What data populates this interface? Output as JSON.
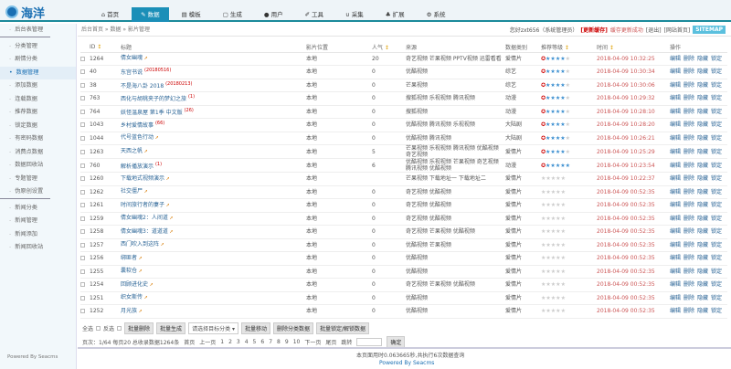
{
  "app": {
    "logo": "海洋"
  },
  "nav": [
    {
      "icon": "home-icon",
      "glyph": "⌂",
      "label": "首页"
    },
    {
      "icon": "edit-icon",
      "glyph": "✎",
      "label": "数据",
      "active": true
    },
    {
      "icon": "file-icon",
      "glyph": "▤",
      "label": "模板"
    },
    {
      "icon": "doc-icon",
      "glyph": "▢",
      "label": "生成"
    },
    {
      "icon": "user-icon",
      "glyph": "●",
      "label": "用户"
    },
    {
      "icon": "wrench-icon",
      "glyph": "✐",
      "label": "工具"
    },
    {
      "icon": "magnet-icon",
      "glyph": "∪",
      "label": "采集"
    },
    {
      "icon": "puzzle-icon",
      "glyph": "♣",
      "label": "扩展"
    },
    {
      "icon": "gear-icon",
      "glyph": "⚙",
      "label": "系统"
    }
  ],
  "sidebar": {
    "items": [
      {
        "label": "后台表管理",
        "sep": true
      },
      {
        "label": "分类管理"
      },
      {
        "label": "剧情分类"
      },
      {
        "label": "数据管理",
        "active": true
      },
      {
        "label": "添加数据"
      },
      {
        "label": "连载数据"
      },
      {
        "label": "推荐数据"
      },
      {
        "label": "锁定数据"
      },
      {
        "label": "有密码数据"
      },
      {
        "label": "消费点数据"
      },
      {
        "label": "数据回收站"
      },
      {
        "label": "专题管理"
      },
      {
        "label": "伪原创设置",
        "sep": true
      },
      {
        "label": "新闻分类"
      },
      {
        "label": "新闻管理"
      },
      {
        "label": "新闻添加"
      },
      {
        "label": "新闻回收站"
      }
    ],
    "powered": "Powered By Seacms"
  },
  "breadcrumb": "后台首页 » 数据 » 影片管理",
  "userbar": {
    "greeting": "您好zxt656（系统管理员）",
    "update_cache": "[更新缓存]",
    "cache_msg": "缓存更新成功",
    "logout": "[退出]",
    "home": "[网站首页]",
    "sitemap": "SITEMAP"
  },
  "table": {
    "headers": [
      "ID",
      "标题",
      "影片位置",
      "人气",
      "来源",
      "数据类别",
      "推荐等级",
      "时间",
      "操作"
    ],
    "ops": [
      "编辑",
      "删除",
      "隐藏",
      "锁定"
    ],
    "rows": [
      {
        "id": "1264",
        "title": "倩女幽魂",
        "tag": "hot",
        "pos": "本地",
        "pop": "20",
        "src": "奇艺视频 芒果视频 PPTV视频 迅雷看看",
        "cat": "爱情片",
        "stars": 4,
        "time": "2018-04-09 10:32:25"
      },
      {
        "id": "40",
        "title": "东宫书说",
        "tag": "(20180516)",
        "pos": "本地",
        "pop": "0",
        "src": "优酷视频",
        "cat": "综艺",
        "stars": 4,
        "time": "2018-04-09 10:30:34"
      },
      {
        "id": "38",
        "title": "不是海八卦 2018",
        "tag": "(20180213)",
        "pos": "本地",
        "pop": "0",
        "src": "芒果视频",
        "cat": "综艺",
        "stars": 4,
        "time": "2018-04-09 10:30:06"
      },
      {
        "id": "763",
        "title": "西化与胡桃夹子的梦幻之旅",
        "tag": "(1)",
        "pos": "本地",
        "pop": "0",
        "src": "搜狐视频 乐视视频 腾讯视频",
        "cat": "动漫",
        "stars": 4,
        "time": "2018-04-09 10:29:32"
      },
      {
        "id": "764",
        "title": "妖怪温泉屋 第1季 中文版",
        "tag": "(26)",
        "pos": "本地",
        "pop": "0",
        "src": "搜狐视频",
        "cat": "动漫",
        "stars": 4,
        "time": "2018-04-09 10:28:10"
      },
      {
        "id": "1043",
        "title": "乡村爱情故事",
        "tag": "(66)",
        "pos": "本地",
        "pop": "0",
        "src": "优酷视频 腾讯视频 乐视视频",
        "cat": "大陆剧",
        "stars": 4,
        "time": "2018-04-09 10:28:20"
      },
      {
        "id": "1044",
        "title": "代号蓝色行动",
        "tag": "hot",
        "pos": "本地",
        "pop": "0",
        "src": "优酷视频 腾讯视频",
        "cat": "大陆剧",
        "stars": 4,
        "time": "2018-04-09 10:26:21"
      },
      {
        "id": "1263",
        "title": "天西之帆",
        "tag": "hot",
        "pos": "本地",
        "pop": "5",
        "src": "芒果视频 乐视视频 腾讯视频 优酷视频 奇艺视频",
        "cat": "爱情片",
        "stars": 4,
        "time": "2018-04-09 10:25:29"
      },
      {
        "id": "760",
        "title": "解析播放演示",
        "tag": "(1)",
        "pos": "本地",
        "pop": "6",
        "src": "优酷视频 乐视视频 芒果视频 奇艺视频 腾讯视频 优酷视频",
        "cat": "动漫",
        "stars": 5,
        "time": "2018-04-09 10:23:54"
      },
      {
        "id": "1260",
        "title": "下载地式视频演示",
        "tag": "hot",
        "pos": "本地",
        "pop": "",
        "src": "芒果视频 下载地址一 下载地址二",
        "cat": "爱情片",
        "stars": 0,
        "time": "2018-04-09 10:22:37"
      },
      {
        "id": "1262",
        "title": "社交僵尸",
        "tag": "hot",
        "pos": "本地",
        "pop": "0",
        "src": "奇艺视频 优酷视频",
        "cat": "爱情片",
        "stars": 0,
        "time": "2018-04-09 00:52:35"
      },
      {
        "id": "1261",
        "title": "时间旅行者的妻子",
        "tag": "hot",
        "pos": "本地",
        "pop": "0",
        "src": "奇艺视频 优酷视频",
        "cat": "爱情片",
        "stars": 0,
        "time": "2018-04-09 00:52:35"
      },
      {
        "id": "1259",
        "title": "倩女幽魂2：人间道",
        "tag": "hot",
        "pos": "本地",
        "pop": "0",
        "src": "奇艺视频 优酷视频",
        "cat": "爱情片",
        "stars": 0,
        "time": "2018-04-09 00:52:35"
      },
      {
        "id": "1258",
        "title": "倩女幽魂3：道道道",
        "tag": "hot",
        "pos": "本地",
        "pop": "0",
        "src": "奇艺视频 芒果视频 优酷视频",
        "cat": "爱情片",
        "stars": 0,
        "time": "2018-04-09 00:52:35"
      },
      {
        "id": "1257",
        "title": "西门吹入到这阵",
        "tag": "hot",
        "pos": "本地",
        "pop": "0",
        "src": "优酷视频 芒果视频",
        "cat": "爱情片",
        "stars": 0,
        "time": "2018-04-09 00:52:35"
      },
      {
        "id": "1256",
        "title": "绑匪者",
        "tag": "hot",
        "pos": "本地",
        "pop": "0",
        "src": "优酷视频",
        "cat": "爱情片",
        "stars": 0,
        "time": "2018-04-09 00:52:35"
      },
      {
        "id": "1255",
        "title": "囊软仓",
        "tag": "hot",
        "pos": "本地",
        "pop": "0",
        "src": "优酷视频",
        "cat": "爱情片",
        "stars": 0,
        "time": "2018-04-09 00:52:35"
      },
      {
        "id": "1254",
        "title": "回顾进化史",
        "tag": "hot",
        "pos": "本地",
        "pop": "0",
        "src": "奇艺视频 芒果视频 优酷视频",
        "cat": "爱情片",
        "stars": 0,
        "time": "2018-04-09 00:52:35"
      },
      {
        "id": "1251",
        "title": "织女斯传",
        "tag": "hot",
        "pos": "本地",
        "pop": "0",
        "src": "优酷视频",
        "cat": "爱情片",
        "stars": 0,
        "time": "2018-04-09 00:52:35"
      },
      {
        "id": "1252",
        "title": "月光族",
        "tag": "hot",
        "pos": "本地",
        "pop": "0",
        "src": "优酷视频",
        "cat": "爱情片",
        "stars": 0,
        "time": "2018-04-09 00:52:35"
      }
    ]
  },
  "actions": {
    "select_all": "全选",
    "invert": "反选",
    "batch_delete": "批量删除",
    "batch_generate": "批量生成",
    "category_select": "请选择目标分类 ▾",
    "batch_move": "批量移动",
    "delete_category": "删除分类数据",
    "batch_lock": "批量锁定/解锁数据"
  },
  "pager": {
    "info": "页次：1/64 每页20 总收录数据1264条",
    "first": "首页",
    "prev": "上一页",
    "pages": [
      "1",
      "2",
      "3",
      "4",
      "5",
      "6",
      "7",
      "8",
      "9",
      "10"
    ],
    "next": "下一页",
    "last": "尾页",
    "jump": "跳转",
    "confirm": "确定"
  },
  "footer": {
    "stat": "本页面用时0.063665秒,共执行6次数据查询",
    "powered": "Powered By Seacms"
  },
  "colors": {
    "accent": "#1b8fb8",
    "hot": "#c00"
  }
}
